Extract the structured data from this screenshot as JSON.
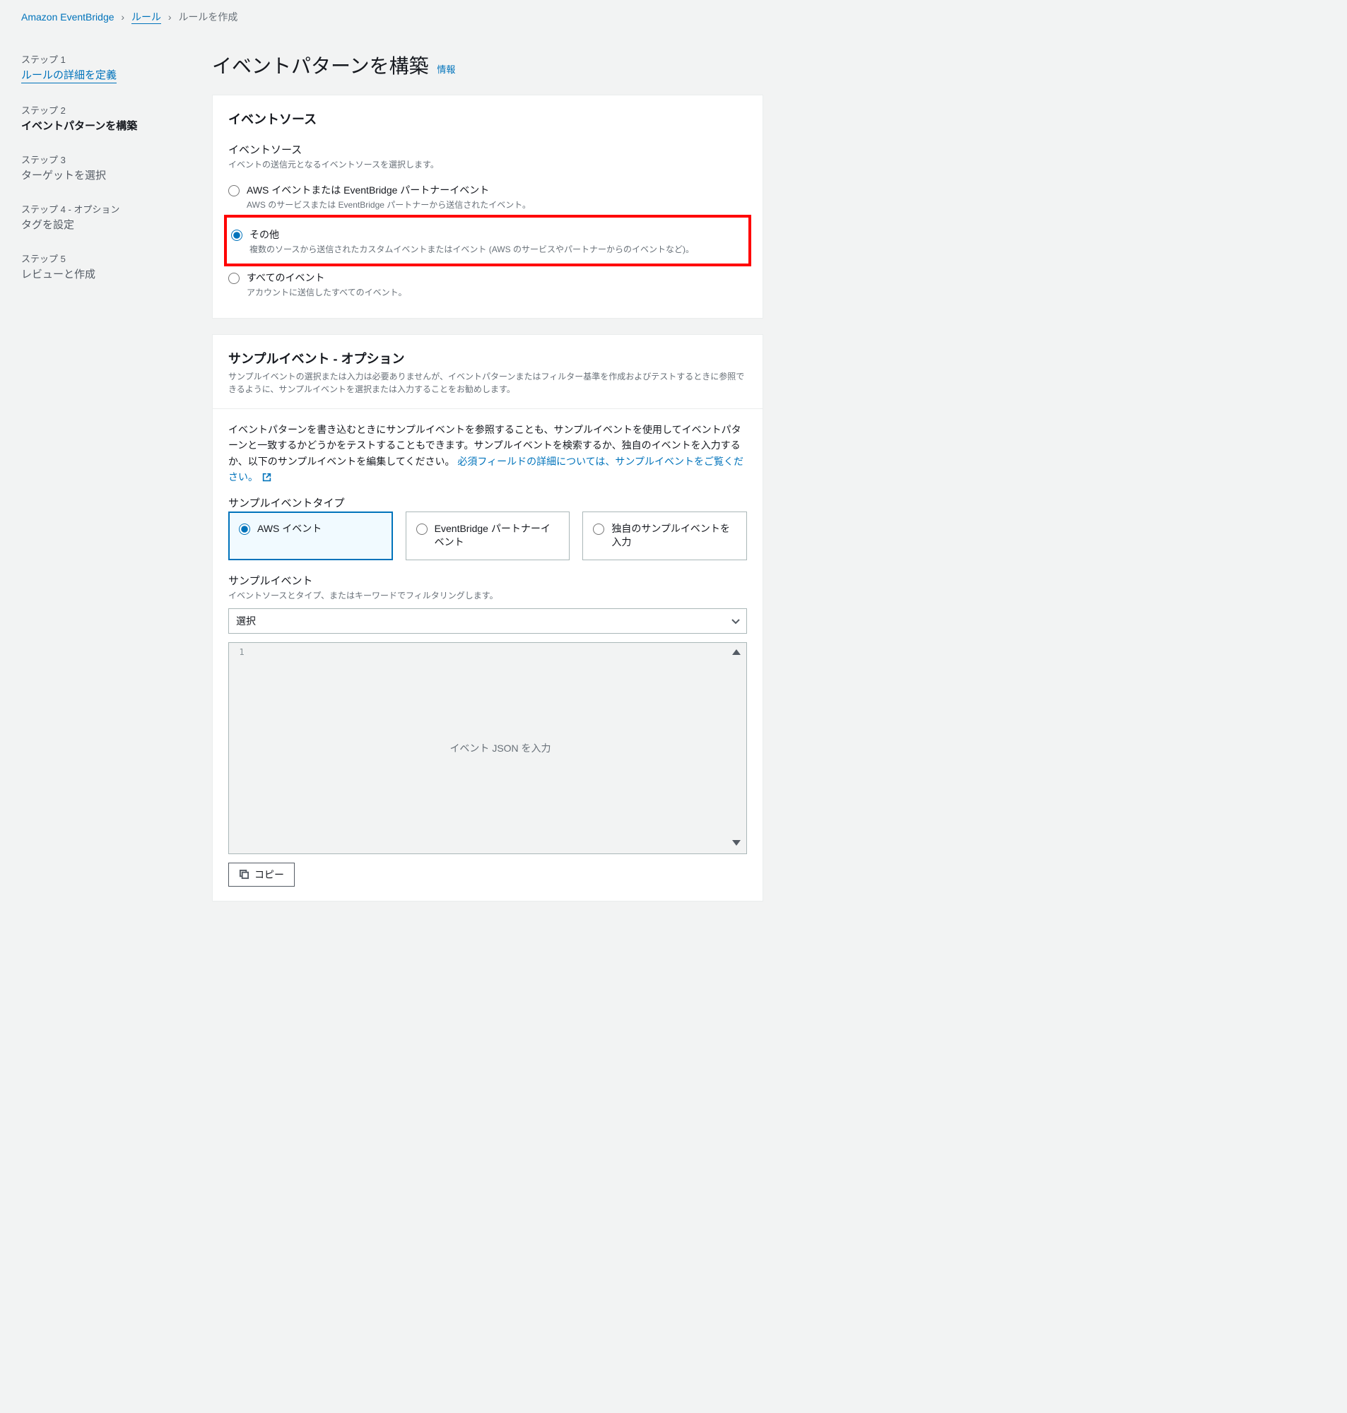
{
  "breadcrumb": {
    "root": "Amazon EventBridge",
    "mid": "ルール",
    "current": "ルールを作成"
  },
  "steps": [
    {
      "label": "ステップ 1",
      "title": "ルールの詳細を定義",
      "state": "link"
    },
    {
      "label": "ステップ 2",
      "title": "イベントパターンを構築",
      "state": "active"
    },
    {
      "label": "ステップ 3",
      "title": "ターゲットを選択",
      "state": "pending"
    },
    {
      "label": "ステップ 4 - オプション",
      "title": "タグを設定",
      "state": "pending"
    },
    {
      "label": "ステップ 5",
      "title": "レビューと作成",
      "state": "pending"
    }
  ],
  "page": {
    "title": "イベントパターンを構築",
    "info": "情報"
  },
  "eventSource": {
    "panelTitle": "イベントソース",
    "fieldLabel": "イベントソース",
    "fieldHint": "イベントの送信元となるイベントソースを選択します。",
    "options": [
      {
        "title": "AWS イベントまたは EventBridge パートナーイベント",
        "desc": "AWS のサービスまたは EventBridge パートナーから送信されたイベント。",
        "checked": false
      },
      {
        "title": "その他",
        "desc": "複数のソースから送信されたカスタムイベントまたはイベント (AWS のサービスやパートナーからのイベントなど)。",
        "checked": true,
        "highlight": true
      },
      {
        "title": "すべてのイベント",
        "desc": "アカウントに送信したすべてのイベント。",
        "checked": false
      }
    ]
  },
  "sample": {
    "panelTitle": "サンプルイベント - オプション",
    "panelDesc": "サンプルイベントの選択または入力は必要ありませんが、イベントパターンまたはフィルター基準を作成およびテストするときに参照できるように、サンプルイベントを選択または入力することをお勧めします。",
    "bodyPre": "イベントパターンを書き込むときにサンプルイベントを参照することも、サンプルイベントを使用してイベントパターンと一致するかどうかをテストすることもできます。サンプルイベントを検索するか、独自のイベントを入力するか、以下のサンプルイベントを編集してください。",
    "bodyLink": "必須フィールドの詳細については、サンプルイベントをご覧ください。",
    "typeLabel": "サンプルイベントタイプ",
    "tiles": [
      {
        "label": "AWS イベント",
        "checked": true
      },
      {
        "label": "EventBridge パートナーイベント",
        "checked": false
      },
      {
        "label": "独自のサンプルイベントを入力",
        "checked": false
      }
    ],
    "eventLabel": "サンプルイベント",
    "eventHint": "イベントソースとタイプ、またはキーワードでフィルタリングします。",
    "selectValue": "選択",
    "editor": {
      "line1": "1",
      "placeholder": "イベント JSON を入力"
    },
    "copy": "コピー"
  }
}
